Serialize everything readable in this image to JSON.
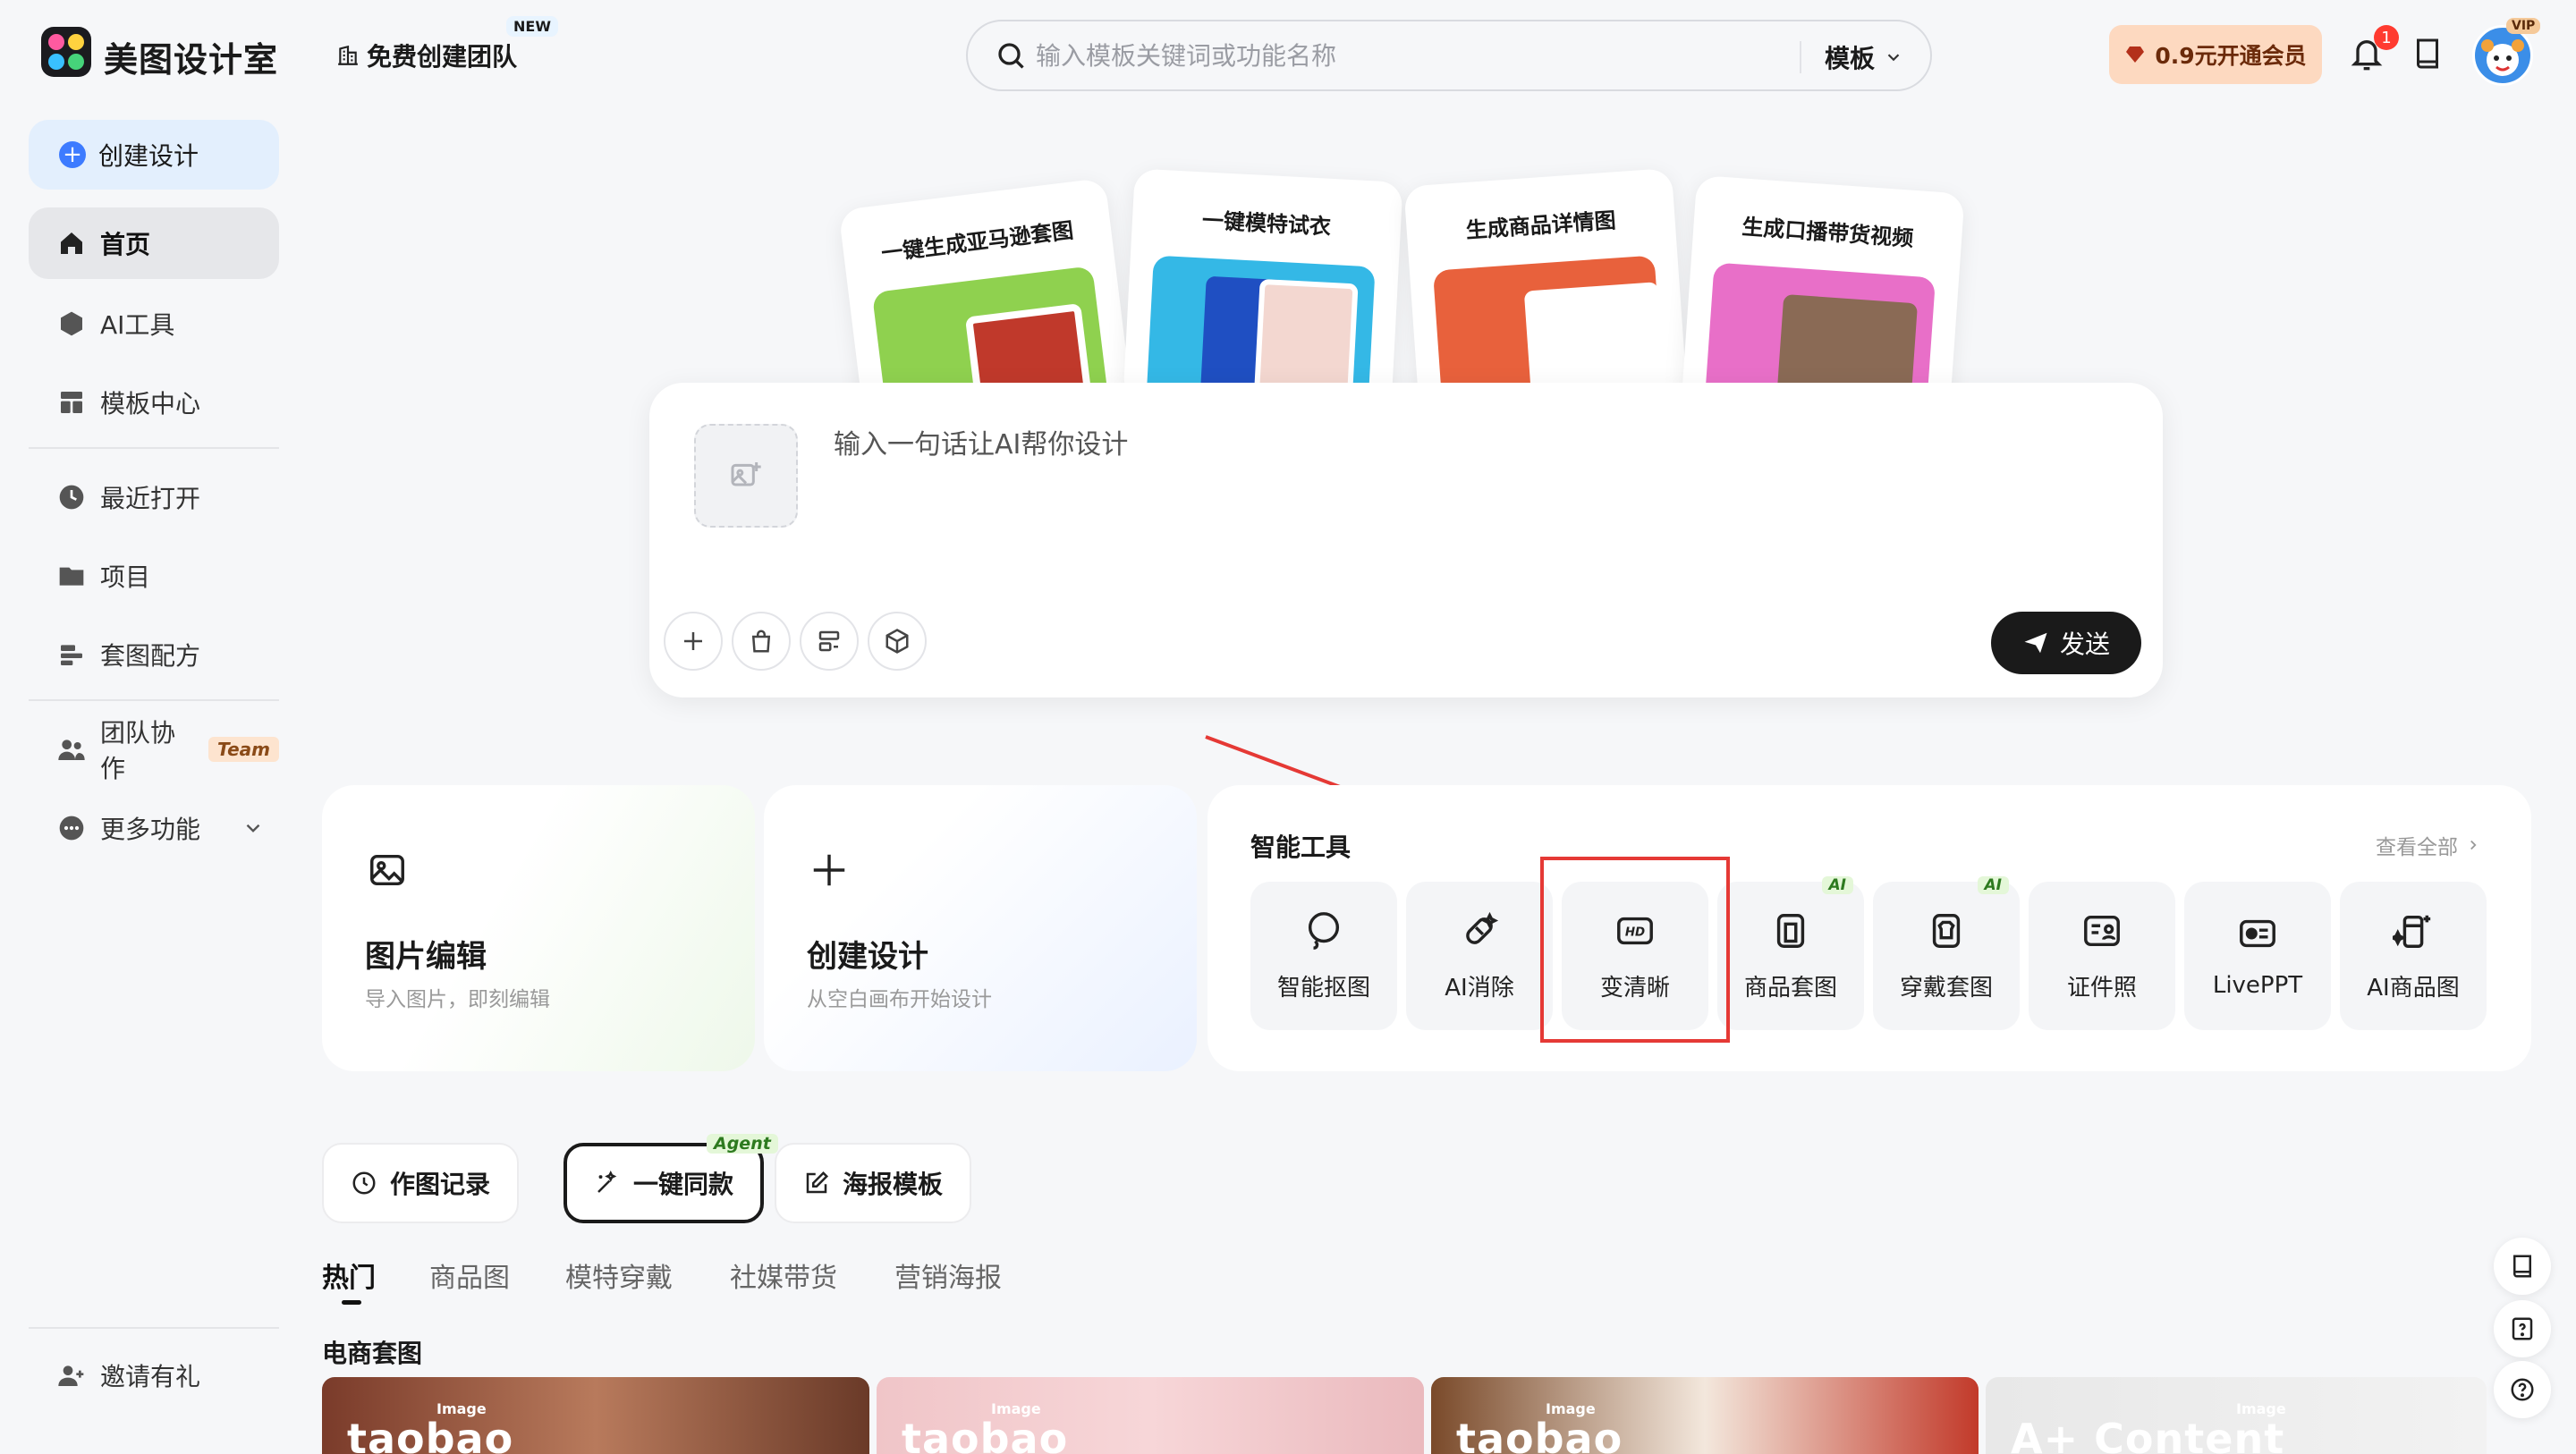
{
  "app": {
    "name": "美图设计室"
  },
  "header": {
    "team_link": "免费创建团队",
    "new_badge": "NEW",
    "search_placeholder": "输入模板关键词或功能名称",
    "search_type": "模板",
    "vip_button": "0.9元开通会员",
    "notification_count": "1",
    "vip_tag": "VIP"
  },
  "sidebar": {
    "create": "创建设计",
    "items": [
      {
        "label": "首页",
        "icon": "home-icon"
      },
      {
        "label": "AI工具",
        "icon": "cube-icon"
      },
      {
        "label": "模板中心",
        "icon": "template-icon"
      },
      {
        "label": "最近打开",
        "icon": "clock-icon"
      },
      {
        "label": "项目",
        "icon": "folder-icon"
      },
      {
        "label": "套图配方",
        "icon": "recipe-icon"
      },
      {
        "label": "团队协作",
        "icon": "team-icon"
      },
      {
        "label": "更多功能",
        "icon": "more-icon"
      }
    ],
    "team_tag": "Team",
    "invite": "邀请有礼"
  },
  "hero_cards": [
    {
      "title": "一键生成亚马逊套图",
      "color": "#8fd14f"
    },
    {
      "title": "一键模特试衣",
      "color": "#34b8e6"
    },
    {
      "title": "生成商品详情图",
      "color": "#e8613c"
    },
    {
      "title": "生成口播带货视频",
      "color": "#e86fc8"
    }
  ],
  "composer": {
    "placeholder": "输入一句话让AI帮你设计",
    "send": "发送"
  },
  "big_cards": [
    {
      "title": "图片编辑",
      "subtitle": "导入图片，即刻编辑"
    },
    {
      "title": "创建设计",
      "subtitle": "从空白画布开始设计"
    }
  ],
  "tools": {
    "title": "智能工具",
    "more": "查看全部",
    "items": [
      {
        "label": "智能抠图",
        "ai": false
      },
      {
        "label": "AI消除",
        "ai": false
      },
      {
        "label": "变清晰",
        "ai": false
      },
      {
        "label": "商品套图",
        "ai": true
      },
      {
        "label": "穿戴套图",
        "ai": true
      },
      {
        "label": "证件照",
        "ai": false
      },
      {
        "label": "LivePPT",
        "ai": false
      },
      {
        "label": "AI商品图",
        "ai": false
      }
    ],
    "ai_tag": "AI"
  },
  "chips": [
    {
      "label": "作图记录"
    },
    {
      "label": "一键同款"
    },
    {
      "label": "海报模板"
    }
  ],
  "agent_tag": "Agent",
  "tabs": [
    "热门",
    "商品图",
    "模特穿戴",
    "社媒带货",
    "营销海报"
  ],
  "section_title": "电商套图",
  "thumbnails": [
    "taobao",
    "taobao",
    "taobao",
    "A+ Content"
  ],
  "thumbnail_small": "Image",
  "colors": {
    "accent": "#3d7bff",
    "highlight": "#e53935",
    "vip": "#fdd9c0"
  }
}
